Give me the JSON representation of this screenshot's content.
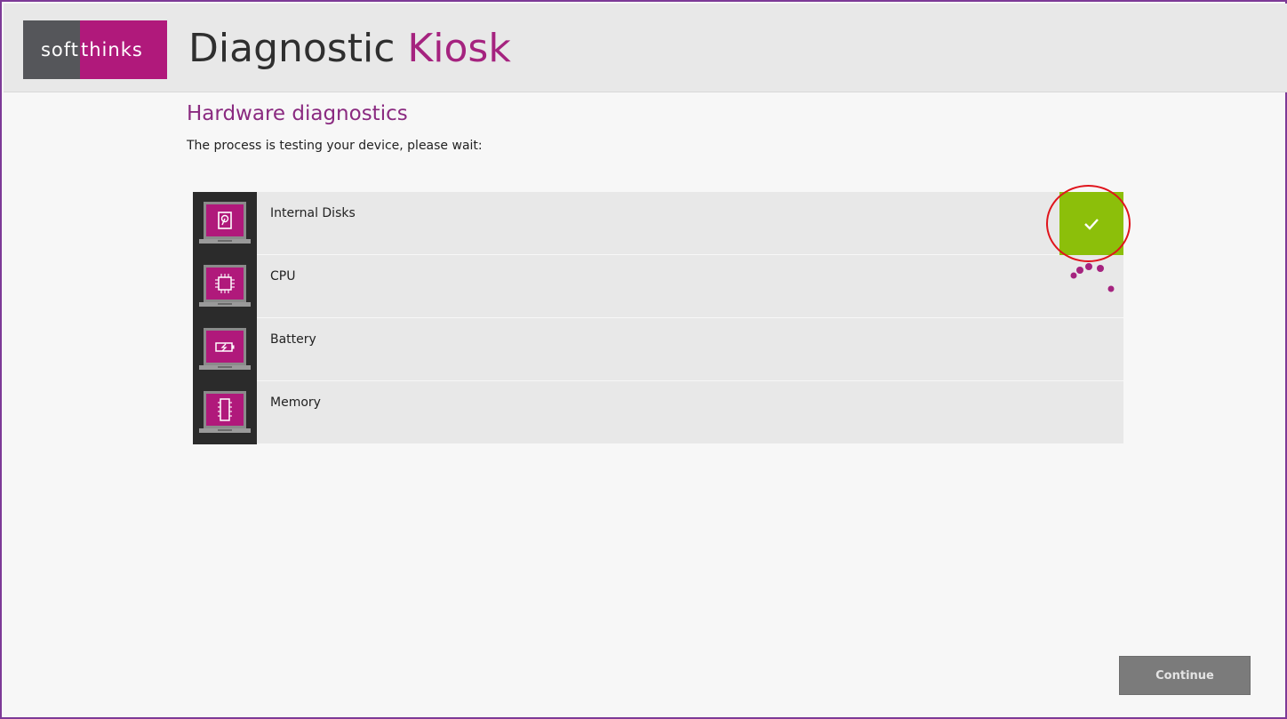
{
  "header": {
    "logo_left": "soft",
    "logo_right": "thinks",
    "title_main": "Diagnostic",
    "title_accent": "Kiosk"
  },
  "page": {
    "title": "Hardware diagnostics",
    "subtitle": "The process is testing your device, please wait:"
  },
  "tests": [
    {
      "label": "Internal Disks",
      "icon": "hard-disk-icon",
      "status": "passed"
    },
    {
      "label": "CPU",
      "icon": "cpu-chip-icon",
      "status": "running"
    },
    {
      "label": "Battery",
      "icon": "battery-icon",
      "status": "pending"
    },
    {
      "label": "Memory",
      "icon": "memory-icon",
      "status": "pending"
    }
  ],
  "footer": {
    "continue_label": "Continue"
  },
  "colors": {
    "brand_purple": "#a5237f",
    "logo_magenta": "#b0197b",
    "logo_gray": "#55565a",
    "pass_green": "#8cbf0a",
    "highlight_red": "#e0141c",
    "button_gray": "#7b7b7b"
  }
}
